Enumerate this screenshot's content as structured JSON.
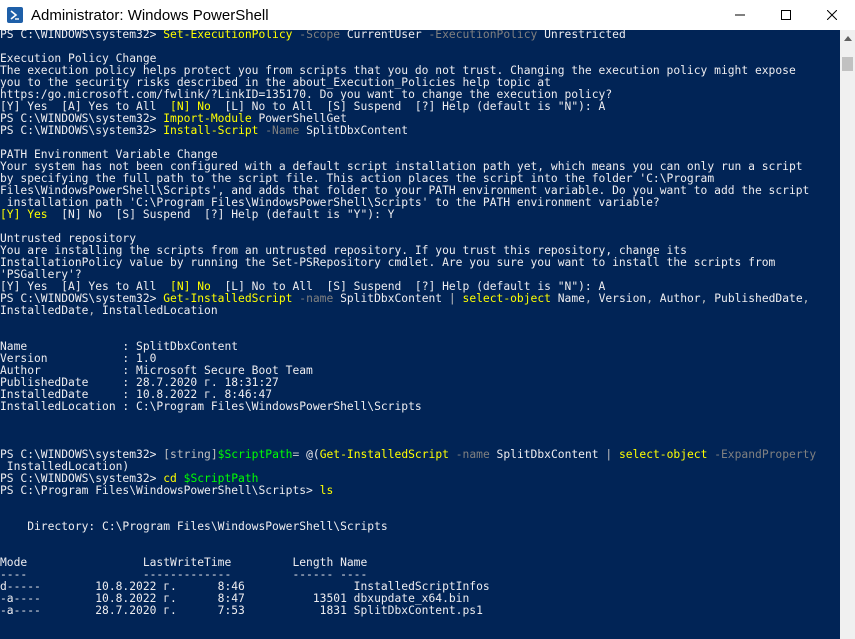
{
  "window": {
    "title": "Administrator: Windows PowerShell",
    "minimize_icon": "minimize-icon",
    "maximize_icon": "maximize-icon",
    "close_icon": "close-icon"
  },
  "console": {
    "lines": [
      [
        [
          "PS C:\\WINDOWS\\system32> ",
          "t"
        ],
        [
          "Set-ExecutionPolicy",
          "cmd"
        ],
        [
          " -Scope",
          "param"
        ],
        [
          " CurrentUser",
          "t"
        ],
        [
          " -ExecutionPolicy",
          "param"
        ],
        [
          " Unrestricted",
          "t"
        ]
      ],
      [
        [
          "",
          "t"
        ]
      ],
      [
        [
          "Execution Policy Change",
          "t"
        ]
      ],
      [
        [
          "The execution policy helps protect you from scripts that you do not trust. Changing the execution policy might expose",
          "t"
        ]
      ],
      [
        [
          "you to the security risks described in the about_Execution_Policies help topic at",
          "t"
        ]
      ],
      [
        [
          "https:/go.microsoft.com/fwlink/?LinkID=135170. Do you want to change the execution policy?",
          "t"
        ]
      ],
      [
        [
          "[Y] Yes  [A] Yes to All  ",
          "t"
        ],
        [
          "[N] No",
          "key"
        ],
        [
          "  [L] No to All  [S] Suspend  [?] Help (default is \"N\"): A",
          "t"
        ]
      ],
      [
        [
          "PS C:\\WINDOWS\\system32> ",
          "t"
        ],
        [
          "Import-Module",
          "cmd"
        ],
        [
          " PowerShellGet",
          "t"
        ]
      ],
      [
        [
          "PS C:\\WINDOWS\\system32> ",
          "t"
        ],
        [
          "Install-Script",
          "cmd"
        ],
        [
          " -Name",
          "param"
        ],
        [
          " SplitDbxContent",
          "t"
        ]
      ],
      [
        [
          "",
          "t"
        ]
      ],
      [
        [
          "PATH Environment Variable Change",
          "t"
        ]
      ],
      [
        [
          "Your system has not been configured with a default script installation path yet, which means you can only run a script",
          "t"
        ]
      ],
      [
        [
          "by specifying the full path to the script file. This action places the script into the folder 'C:\\Program",
          "t"
        ]
      ],
      [
        [
          "Files\\WindowsPowerShell\\Scripts', and adds that folder to your PATH environment variable. Do you want to add the script",
          "t"
        ]
      ],
      [
        [
          " installation path 'C:\\Program Files\\WindowsPowerShell\\Scripts' to the PATH environment variable?",
          "t"
        ]
      ],
      [
        [
          "[Y] Yes",
          "key"
        ],
        [
          "  [N] No  [S] Suspend  [?] Help (default is \"Y\"): Y",
          "t"
        ]
      ],
      [
        [
          "",
          "t"
        ]
      ],
      [
        [
          "Untrusted repository",
          "t"
        ]
      ],
      [
        [
          "You are installing the scripts from an untrusted repository. If you trust this repository, change its",
          "t"
        ]
      ],
      [
        [
          "InstallationPolicy value by running the Set-PSRepository cmdlet. Are you sure you want to install the scripts from",
          "t"
        ]
      ],
      [
        [
          "'PSGallery'?",
          "t"
        ]
      ],
      [
        [
          "[Y] Yes  [A] Yes to All  ",
          "t"
        ],
        [
          "[N] No",
          "key"
        ],
        [
          "  [L] No to All  [S] Suspend  [?] Help (default is \"N\"): A",
          "t"
        ]
      ],
      [
        [
          "PS C:\\WINDOWS\\system32> ",
          "t"
        ],
        [
          "Get-InstalledScript",
          "cmd"
        ],
        [
          " -name",
          "param"
        ],
        [
          " SplitDbxContent ",
          "t"
        ],
        [
          "|",
          "op"
        ],
        [
          " select-object",
          "cmd"
        ],
        [
          " Name",
          "t"
        ],
        [
          ",",
          "op"
        ],
        [
          " Version",
          "t"
        ],
        [
          ",",
          "op"
        ],
        [
          " Author",
          "t"
        ],
        [
          ",",
          "op"
        ],
        [
          " PublishedDate",
          "t"
        ],
        [
          ",",
          "op"
        ]
      ],
      [
        [
          "InstalledDate",
          "t"
        ],
        [
          ",",
          "op"
        ],
        [
          " InstalledLocation",
          "t"
        ]
      ],
      [
        [
          "",
          "t"
        ]
      ],
      [
        [
          "",
          "t"
        ]
      ],
      [
        [
          "Name              : SplitDbxContent",
          "t"
        ]
      ],
      [
        [
          "Version           : 1.0",
          "t"
        ]
      ],
      [
        [
          "Author            : Microsoft Secure Boot Team",
          "t"
        ]
      ],
      [
        [
          "PublishedDate     : 28.7.2020 г. 18:31:27",
          "t"
        ]
      ],
      [
        [
          "InstalledDate     : 10.8.2022 г. 8:46:47",
          "t"
        ]
      ],
      [
        [
          "InstalledLocation : C:\\Program Files\\WindowsPowerShell\\Scripts",
          "t"
        ]
      ],
      [
        [
          "",
          "t"
        ]
      ],
      [
        [
          "",
          "t"
        ]
      ],
      [
        [
          "",
          "t"
        ]
      ],
      [
        [
          "PS C:\\WINDOWS\\system32> ",
          "t"
        ],
        [
          "[string]",
          "op"
        ],
        [
          "$ScriptPath",
          "var"
        ],
        [
          "=",
          "op"
        ],
        [
          " @(",
          "t"
        ],
        [
          "Get-InstalledScript",
          "cmd"
        ],
        [
          " -name",
          "param"
        ],
        [
          " SplitDbxContent ",
          "t"
        ],
        [
          "|",
          "op"
        ],
        [
          " select-object",
          "cmd"
        ],
        [
          " -ExpandProperty",
          "param"
        ]
      ],
      [
        [
          " InstalledLocation)",
          "t"
        ]
      ],
      [
        [
          "PS C:\\WINDOWS\\system32> ",
          "t"
        ],
        [
          "cd",
          "cmd"
        ],
        [
          " $ScriptPath",
          "var"
        ]
      ],
      [
        [
          "PS C:\\Program Files\\WindowsPowerShell\\Scripts> ",
          "t"
        ],
        [
          "ls",
          "cmd"
        ]
      ],
      [
        [
          "",
          "t"
        ]
      ],
      [
        [
          "",
          "t"
        ]
      ],
      [
        [
          "    Directory: C:\\Program Files\\WindowsPowerShell\\Scripts",
          "t"
        ]
      ],
      [
        [
          "",
          "t"
        ]
      ],
      [
        [
          "",
          "t"
        ]
      ],
      [
        [
          "Mode                 LastWriteTime         Length Name",
          "t"
        ]
      ],
      [
        [
          "----                 -------------         ------ ----",
          "t"
        ]
      ],
      [
        [
          "d-----        10.8.2022 г.      8:46                InstalledScriptInfos",
          "t"
        ]
      ],
      [
        [
          "-a----        10.8.2022 г.      8:47          13501 dbxupdate_x64.bin",
          "t"
        ]
      ],
      [
        [
          "-a----        28.7.2020 г.      7:53           1831 SplitDbxContent.ps1",
          "t"
        ]
      ]
    ]
  }
}
